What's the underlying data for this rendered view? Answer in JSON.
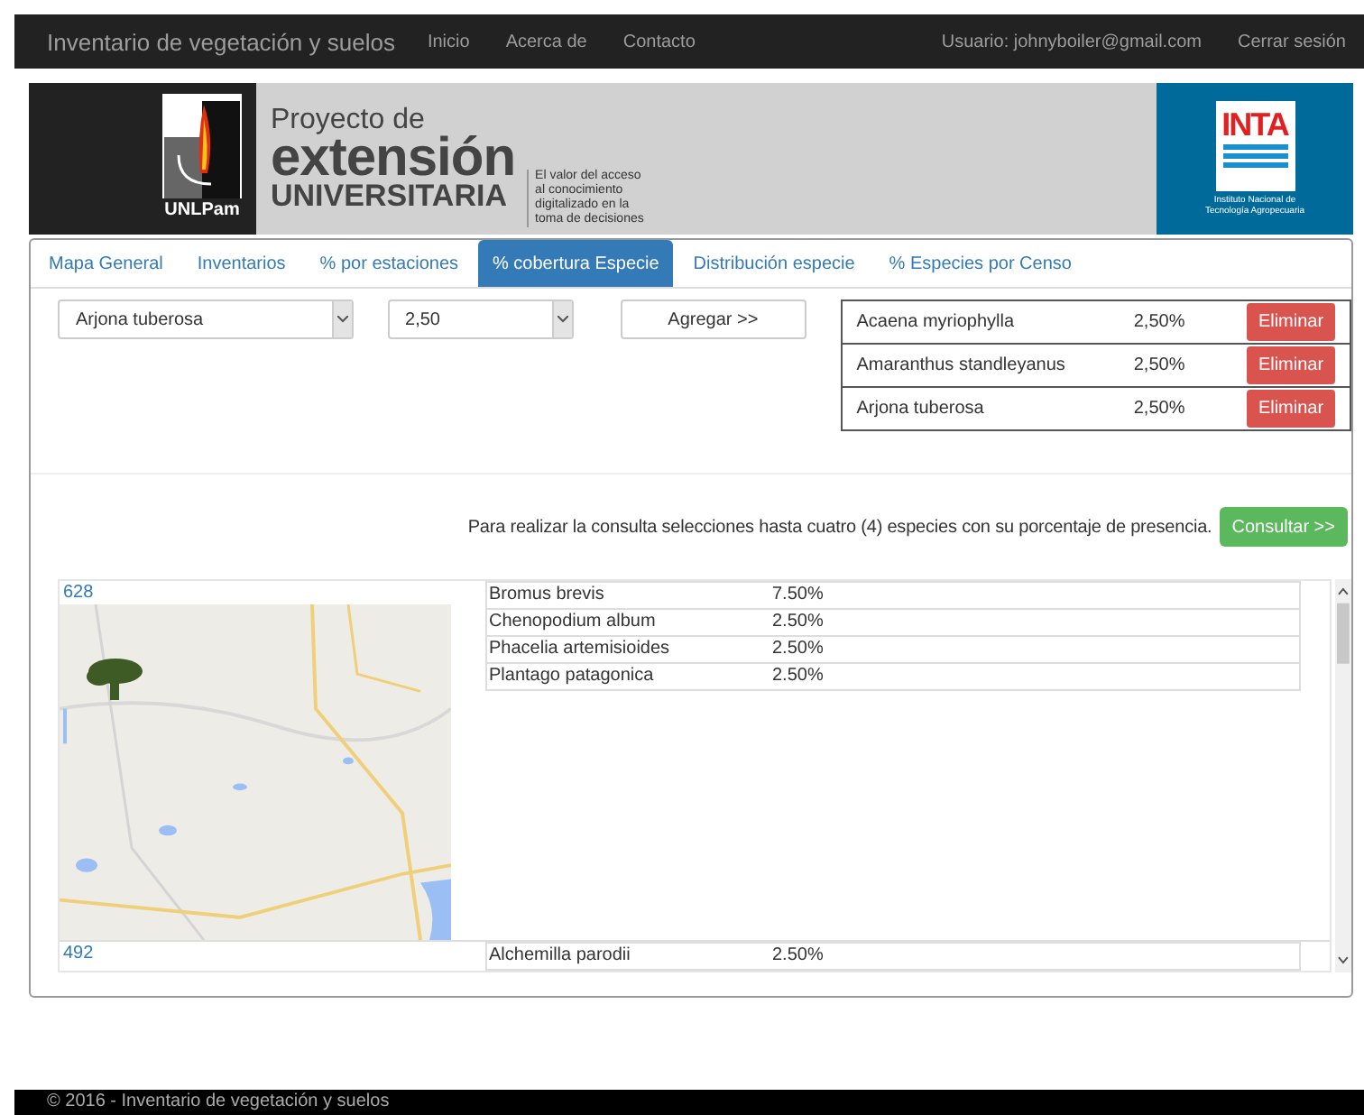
{
  "navbar": {
    "brand": "Inventario de vegetación y suelos",
    "links": [
      "Inicio",
      "Acerca de",
      "Contacto"
    ],
    "user": "Usuario: johnyboiler@gmail.com",
    "logout": "Cerrar sesión"
  },
  "banner": {
    "left_logo": "UNLPam",
    "title_top": "Proyecto de",
    "title_main": "extensión",
    "title_bottom": "UNIVERSITARIA",
    "tagline": [
      "El valor del acceso",
      "al conocimiento",
      "digitalizado en la",
      "toma de decisiones"
    ],
    "right_logo": "INTA",
    "right_caption": [
      "Instituto Nacional de",
      "Tecnología Agropecuaria"
    ]
  },
  "tabs": [
    {
      "label": "Mapa General",
      "selected": false
    },
    {
      "label": "Inventarios",
      "selected": false
    },
    {
      "label": "% por estaciones",
      "selected": false
    },
    {
      "label": "% cobertura Especie",
      "selected": true
    },
    {
      "label": "Distribución especie",
      "selected": false
    },
    {
      "label": "% Especies por Censo",
      "selected": false
    }
  ],
  "form": {
    "species_select": "Arjona tuberosa",
    "percent_select": "2,50",
    "add_button": "Agregar >>"
  },
  "selected_species": [
    {
      "name": "Acaena myriophylla",
      "percent": "2,50%",
      "remove_button": "Eliminar"
    },
    {
      "name": "Amaranthus standleyanus",
      "percent": "2,50%",
      "remove_button": "Eliminar"
    },
    {
      "name": "Arjona tuberosa",
      "percent": "2,50%",
      "remove_button": "Eliminar"
    }
  ],
  "hint": "Para realizar la consulta selecciones hasta cuatro (4) especies con su porcentaje de presencia.",
  "consult_button": "Consultar >>",
  "results": [
    {
      "id": "628",
      "rows": [
        {
          "species": "Bromus brevis",
          "percent": "7.50%"
        },
        {
          "species": "Chenopodium album",
          "percent": "2.50%"
        },
        {
          "species": "Phacelia artemisioides",
          "percent": "2.50%"
        },
        {
          "species": "Plantago patagonica",
          "percent": "2.50%"
        }
      ]
    },
    {
      "id": "492",
      "rows": [
        {
          "species": "Alchemilla parodii",
          "percent": "2.50%"
        }
      ]
    }
  ],
  "footer": "© 2016 - Inventario de vegetación y suelos"
}
